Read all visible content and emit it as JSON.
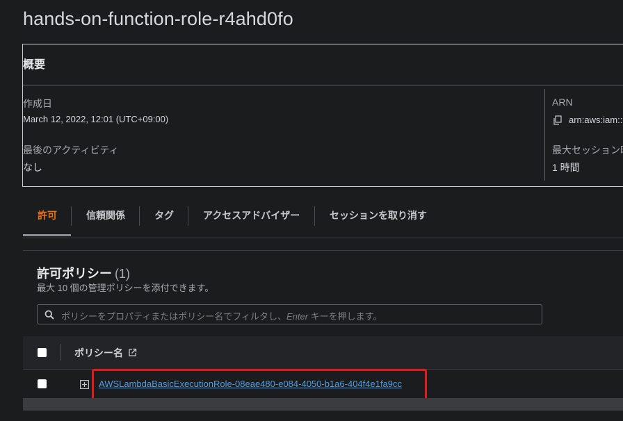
{
  "page": {
    "title": "hands-on-function-role-r4ahd0fo"
  },
  "summary": {
    "title": "概要",
    "created_label": "作成日",
    "created_value": "March 12, 2022, 12:01 (UTC+09:00)",
    "last_activity_label": "最後のアクティビティ",
    "last_activity_value": "なし",
    "arn_label": "ARN",
    "arn_value": "arn:aws:iam::",
    "max_session_label": "最大セッション時",
    "max_session_value": "1 時間"
  },
  "tabs": [
    {
      "label": "許可",
      "active": true
    },
    {
      "label": "信頼関係"
    },
    {
      "label": "タグ"
    },
    {
      "label": "アクセスアドバイザー"
    },
    {
      "label": "セッションを取り消す"
    }
  ],
  "policies": {
    "title": "許可ポリシー",
    "count": "(1)",
    "description": "最大 10 個の管理ポリシーを添付できます。",
    "search_placeholder_pre": "ポリシーをプロパティまたはポリシー名でフィルタし、",
    "search_placeholder_key": "Enter",
    "search_placeholder_post": " キーを押します。",
    "column_name": "ポリシー名",
    "rows": [
      {
        "name": "AWSLambdaBasicExecutionRole-08eae480-e084-4050-b1a6-404f4e1fa9cc"
      }
    ]
  },
  "colors": {
    "accent": "#ec7211",
    "link": "#539fe5",
    "highlight": "#e31b1b"
  }
}
